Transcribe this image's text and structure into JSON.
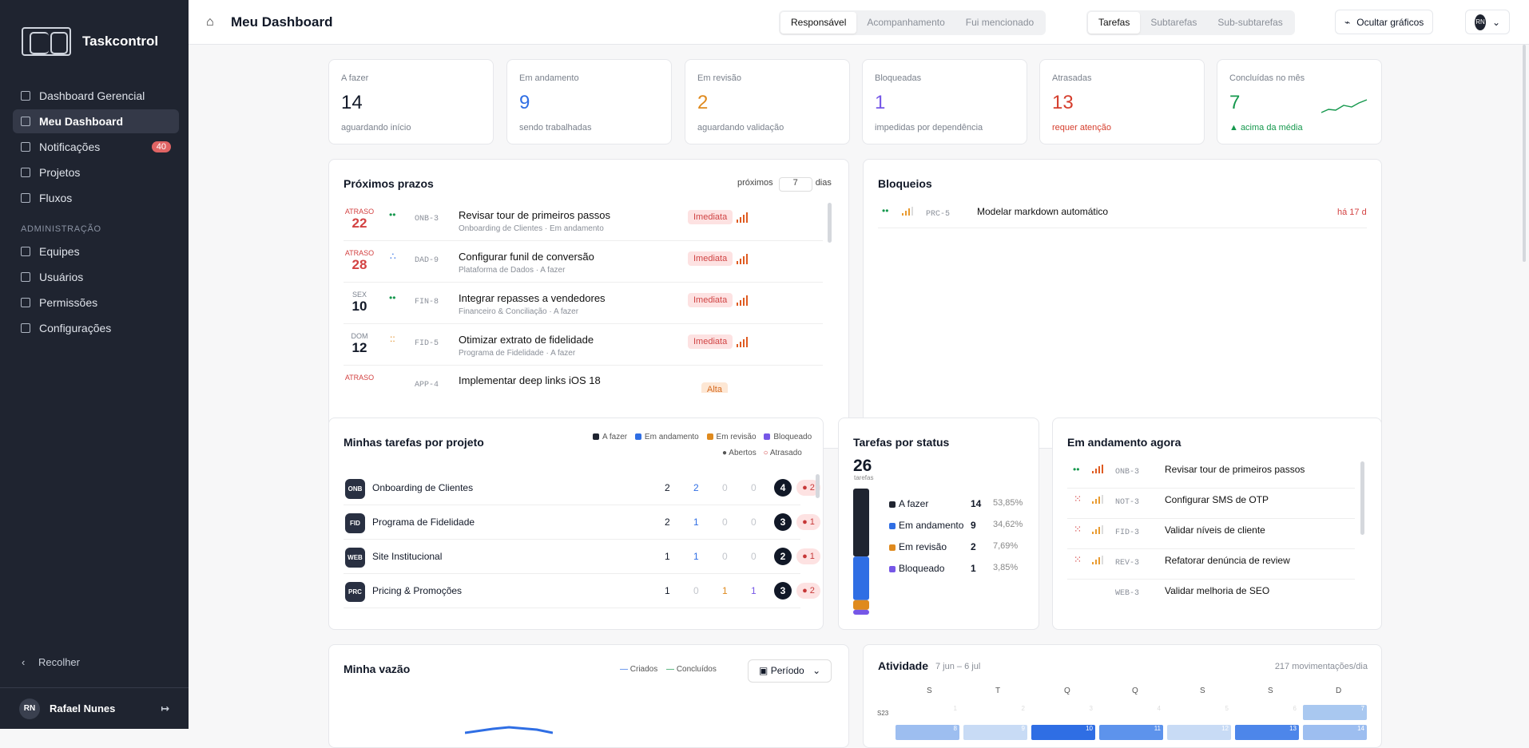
{
  "app": {
    "name": "Taskcontrol"
  },
  "sidebar": {
    "items": [
      {
        "label": "Dashboard Gerencial"
      },
      {
        "label": "Meu Dashboard"
      },
      {
        "label": "Notificações",
        "badge": "40"
      },
      {
        "label": "Projetos"
      },
      {
        "label": "Fluxos"
      }
    ],
    "section": "ADMINISTRAÇÃO",
    "admin": [
      {
        "label": "Equipes"
      },
      {
        "label": "Usuários"
      },
      {
        "label": "Permissões"
      },
      {
        "label": "Configurações"
      }
    ],
    "collapse": "Recolher",
    "user": {
      "initials": "RN",
      "name": "Rafael Nunes"
    }
  },
  "header": {
    "title": "Meu Dashboard",
    "tabs1": [
      "Responsável",
      "Acompanhamento",
      "Fui mencionado"
    ],
    "tabs2": [
      "Tarefas",
      "Subtarefas",
      "Sub-subtarefas"
    ],
    "hide": "Ocultar gráficos",
    "avatar": "RN"
  },
  "metrics": [
    {
      "label": "A fazer",
      "value": "14",
      "sub": "aguardando início",
      "color": "#111827"
    },
    {
      "label": "Em andamento",
      "value": "9",
      "sub": "sendo trabalhadas",
      "color": "#2f6ee4"
    },
    {
      "label": "Em revisão",
      "value": "2",
      "sub": "aguardando validação",
      "color": "#df8a1e"
    },
    {
      "label": "Bloqueadas",
      "value": "1",
      "sub": "impedidas por dependência",
      "color": "#7657e7"
    },
    {
      "label": "Atrasadas",
      "value": "13",
      "sub": "requer atenção",
      "color": "#d53e2d"
    },
    {
      "label": "Concluídas no mês",
      "value": "7",
      "sub": "▲ acima da média",
      "color": "#15984d"
    }
  ],
  "deadlines": {
    "title": "Próximos prazos",
    "prefix": "próximos",
    "days": "7",
    "suffix": "dias",
    "rows": [
      {
        "top": "ATRASO",
        "day": "22",
        "code": "ONB-3",
        "task": "Revisar tour de primeiros passos",
        "meta": "Onboarding de Clientes · Em andamento",
        "pill": "Imediata"
      },
      {
        "top": "ATRASO",
        "day": "28",
        "code": "DAD-9",
        "task": "Configurar funil de conversão",
        "meta": "Plataforma de Dados · A fazer",
        "pill": "Imediata"
      },
      {
        "top": "SEX",
        "day": "10",
        "code": "FIN-8",
        "task": "Integrar repasses a vendedores",
        "meta": "Financeiro & Conciliação · A fazer",
        "pill": "Imediata"
      },
      {
        "top": "DOM",
        "day": "12",
        "code": "FID-5",
        "task": "Otimizar extrato de fidelidade",
        "meta": "Programa de Fidelidade · A fazer",
        "pill": "Imediata"
      },
      {
        "top": "ATRASO",
        "day": "",
        "code": "APP-4",
        "task": "Implementar deep links iOS 18",
        "meta": "",
        "pill": "Alta"
      }
    ]
  },
  "blocks": {
    "title": "Bloqueios",
    "code": "PRC-5",
    "task": "Modelar markdown automático",
    "age": "há 17 d"
  },
  "projects": {
    "title": "Minhas tarefas por projeto",
    "legend": [
      "A fazer",
      "Em andamento",
      "Em revisão",
      "Bloqueado",
      "Abertos",
      "Atrasado"
    ],
    "rows": [
      {
        "tag": "ONB",
        "name": "Onboarding de Clientes",
        "a": "2",
        "b": "2",
        "c": "0",
        "d": "0",
        "open": "4",
        "late": "● 2"
      },
      {
        "tag": "FID",
        "name": "Programa de Fidelidade",
        "a": "2",
        "b": "1",
        "c": "0",
        "d": "0",
        "open": "3",
        "late": "● 1"
      },
      {
        "tag": "WEB",
        "name": "Site Institucional",
        "a": "1",
        "b": "1",
        "c": "0",
        "d": "0",
        "open": "2",
        "late": "● 1"
      },
      {
        "tag": "PRC",
        "name": "Pricing & Promoções",
        "a": "1",
        "b": "0",
        "c": "1",
        "d": "1",
        "open": "3",
        "late": "● 2"
      }
    ]
  },
  "status": {
    "title": "Tarefas por status",
    "total": "26",
    "unit": "tarefas",
    "rows": [
      {
        "label": "A fazer",
        "count": "14",
        "pct": "53,85%",
        "value": 14,
        "color": "#1f2430"
      },
      {
        "label": "Em andamento",
        "count": "9",
        "pct": "34,62%",
        "value": 9,
        "color": "#2f6ee4"
      },
      {
        "label": "Em revisão",
        "count": "2",
        "pct": "7,69%",
        "value": 2,
        "color": "#df8a1e"
      },
      {
        "label": "Bloqueado",
        "count": "1",
        "pct": "3,85%",
        "value": 1,
        "color": "#7657e7"
      }
    ]
  },
  "active": {
    "title": "Em andamento agora",
    "rows": [
      {
        "code": "ONB-3",
        "task": "Revisar tour de primeiros passos"
      },
      {
        "code": "NOT-3",
        "task": "Configurar SMS de OTP"
      },
      {
        "code": "FID-3",
        "task": "Validar níveis de cliente"
      },
      {
        "code": "REV-3",
        "task": "Refatorar denúncia de review"
      },
      {
        "code": "WEB-3",
        "task": "Validar melhoria de SEO"
      }
    ]
  },
  "flow": {
    "title": "Minha vazão",
    "created": "Criados",
    "done": "Concluídos",
    "period": "Período"
  },
  "activity": {
    "title": "Atividade",
    "range": "7 jun – 6 jul",
    "rate": "217 movimentações/dia",
    "weekdays": [
      "S",
      "T",
      "Q",
      "Q",
      "S",
      "S",
      "D"
    ],
    "week": "S23",
    "days": [
      "1",
      "2",
      "3",
      "4",
      "5",
      "6",
      "7"
    ],
    "next": [
      "8",
      "9",
      "10",
      "11",
      "12",
      "13",
      "14"
    ]
  }
}
